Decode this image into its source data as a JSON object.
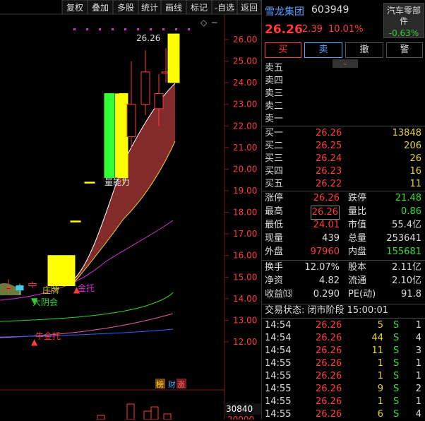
{
  "toolbar": [
    "复权",
    "叠加",
    "多股",
    "统计",
    "画线",
    "标记",
    "-自选",
    "返回"
  ],
  "chart": {
    "y_ticks": [
      "26.00",
      "25.00",
      "24.00",
      "23.00",
      "22.00",
      "21.00",
      "20.00",
      "19.00",
      "18.00",
      "17.00",
      "16.00",
      "15.00",
      "14.00",
      "13.00",
      "12.00"
    ],
    "candle_values": [
      {
        "o": 14.5,
        "c": 14.5,
        "h": 14.9,
        "l": 14.3
      },
      {
        "o": 14.4,
        "c": 14.6,
        "h": 14.7,
        "l": 14.2
      },
      {
        "o": 14.6,
        "c": 14.7,
        "h": 14.8,
        "l": 14.5
      },
      {
        "o": 14.6,
        "c": 16.0,
        "h": 16.0,
        "l": 14.6
      },
      {
        "o": 17.6,
        "c": 17.6,
        "h": 17.6,
        "l": 17.6
      },
      {
        "o": 19.4,
        "c": 19.4,
        "h": 19.4,
        "l": 19.4
      },
      {
        "o": 19.6,
        "c": 23.5,
        "h": 23.5,
        "l": 19.6
      },
      {
        "o": 19.6,
        "c": 23.5,
        "h": 23.5,
        "l": 19.3
      },
      {
        "o": 21.5,
        "c": 23.0,
        "h": 25.0,
        "l": 21.0
      },
      {
        "o": 23.0,
        "c": 24.5,
        "h": 25.5,
        "l": 22.5
      },
      {
        "o": 22.8,
        "c": 23.5,
        "h": 24.4,
        "l": 22.0
      },
      {
        "o": 24.5,
        "c": 24.5,
        "h": 25.6,
        "l": 24.0
      },
      {
        "o": 24.01,
        "c": 26.26,
        "h": 26.26,
        "l": 24.01
      }
    ],
    "last_label": "26.26",
    "annotations": [
      "庄牌",
      "大阴会",
      "金托",
      "量能力",
      "牛金托"
    ],
    "badge1": "榜",
    "badge2": "财",
    "badge3": "涨",
    "volume_label": "30840",
    "vol_tick_partial": "20000"
  },
  "header": {
    "name": "雪龙集团",
    "code": "603949",
    "price": "26.26",
    "change": "2.39",
    "pct": "10.01%",
    "sector": "汽车零部件",
    "sector_pct": "-0.63%"
  },
  "trade_buttons": [
    "买",
    "卖",
    "撤",
    "警"
  ],
  "sell_levels": [
    "卖五",
    "卖四",
    "卖三",
    "卖二",
    "卖一"
  ],
  "buy_levels": [
    {
      "label": "买一",
      "price": "26.26",
      "vol": "13848"
    },
    {
      "label": "买二",
      "price": "26.25",
      "vol": "206"
    },
    {
      "label": "买三",
      "price": "26.24",
      "vol": "26"
    },
    {
      "label": "买四",
      "price": "26.23",
      "vol": "16"
    },
    {
      "label": "买五",
      "price": "26.22",
      "vol": "11"
    }
  ],
  "stats": [
    [
      {
        "k": "涨停",
        "v": "26.26",
        "c": "red"
      },
      {
        "k": "跌停",
        "v": "21.48",
        "c": "green"
      }
    ],
    [
      {
        "k": "最高",
        "v": "26.26",
        "c": "red"
      },
      {
        "k": "量比",
        "v": "0.86",
        "c": "green"
      }
    ],
    [
      {
        "k": "最低",
        "v": "24.01",
        "c": "red"
      },
      {
        "k": "市值",
        "v": "55.4亿",
        "c": "white"
      }
    ],
    [
      {
        "k": "现量",
        "v": "439",
        "c": "white"
      },
      {
        "k": "总量",
        "v": "253641",
        "c": "white"
      }
    ],
    [
      {
        "k": "外盘",
        "v": "97960",
        "c": "red"
      },
      {
        "k": "内盘",
        "v": "155681",
        "c": "green"
      }
    ]
  ],
  "stats2": [
    [
      {
        "k": "换手",
        "v": "12.07%"
      },
      {
        "k": "股本",
        "v": "2.11亿"
      }
    ],
    [
      {
        "k": "净资",
        "v": "4.82"
      },
      {
        "k": "流通",
        "v": "2.10亿"
      }
    ],
    [
      {
        "k": "收益⒀",
        "v": "0.290"
      },
      {
        "k": "PE(动)",
        "v": "91.8"
      }
    ]
  ],
  "trade_status": "交易状态: 闭市阶段 15:00:01",
  "ticks": [
    {
      "t": "14:54",
      "p": "26.26",
      "v": "5",
      "s": "S",
      "n": "1"
    },
    {
      "t": "14:54",
      "p": "26.26",
      "v": "44",
      "s": "S",
      "n": "4"
    },
    {
      "t": "14:54",
      "p": "26.26",
      "v": "11",
      "s": "S",
      "n": "3"
    },
    {
      "t": "14:55",
      "p": "26.26",
      "v": "1",
      "s": "S",
      "n": "1"
    },
    {
      "t": "14:55",
      "p": "26.26",
      "v": "1",
      "s": "S",
      "n": "1"
    },
    {
      "t": "14:55",
      "p": "26.26",
      "v": "9",
      "s": "S",
      "n": "2"
    },
    {
      "t": "14:55",
      "p": "26.26",
      "v": "1",
      "s": "S",
      "n": "1"
    },
    {
      "t": "14:55",
      "p": "26.26",
      "v": "6",
      "s": "S",
      "n": "4"
    }
  ]
}
